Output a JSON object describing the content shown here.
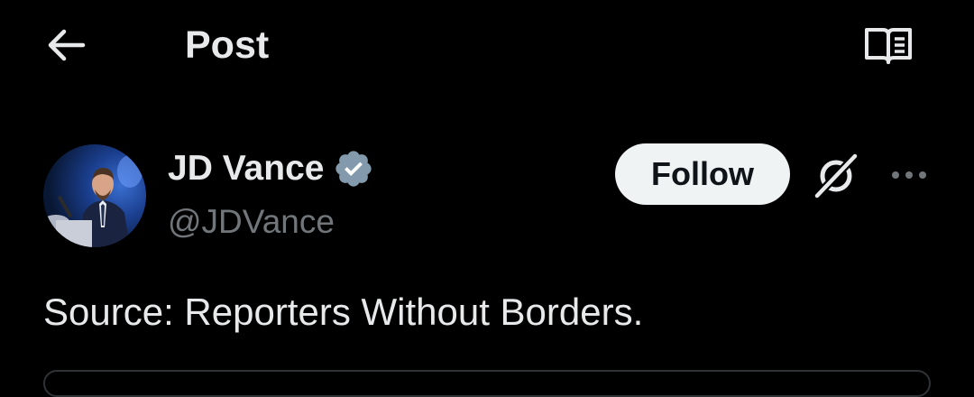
{
  "header": {
    "title": "Post",
    "back_icon": "arrow-left-icon",
    "reader_icon": "reader-mode-icon"
  },
  "author": {
    "display_name": "JD Vance",
    "handle": "@JDVance",
    "verified_icon": "verified-badge-icon",
    "verified_color": "#829aab",
    "follow_label": "Follow",
    "grok_icon": "grok-icon",
    "more_icon": "more-horizontal-icon"
  },
  "post": {
    "text": "Source: Reporters Without Borders."
  },
  "colors": {
    "background": "#000000",
    "text_primary": "#e7e9ea",
    "text_secondary": "#71767b",
    "follow_bg": "#eff3f4",
    "follow_text": "#0f1419"
  }
}
